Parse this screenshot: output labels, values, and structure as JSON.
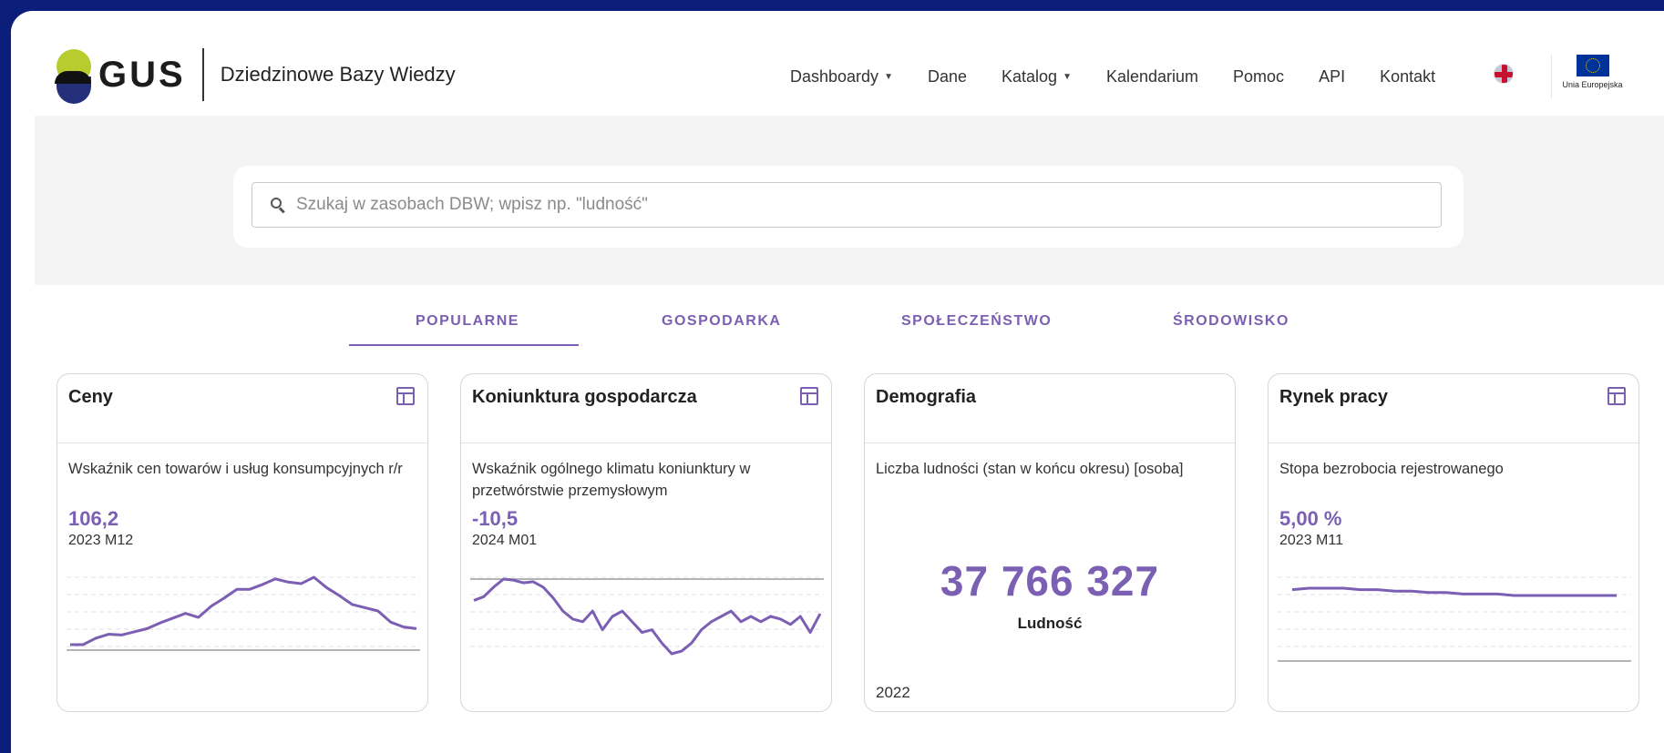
{
  "header": {
    "logo_text": "GUS",
    "site_title": "Dziedzinowe Bazy Wiedzy",
    "nav": [
      {
        "label": "Dashboardy",
        "dropdown": true
      },
      {
        "label": "Dane",
        "dropdown": false
      },
      {
        "label": "Katalog",
        "dropdown": true
      },
      {
        "label": "Kalendarium",
        "dropdown": false
      },
      {
        "label": "Pomoc",
        "dropdown": false
      },
      {
        "label": "API",
        "dropdown": false
      },
      {
        "label": "Kontakt",
        "dropdown": false
      }
    ],
    "language_icon": "uk-flag-icon",
    "eu_label": "Unia Europejska"
  },
  "search": {
    "placeholder": "Szukaj w zasobach DBW; wpisz np. \"ludność\""
  },
  "tabs": [
    {
      "label": "POPULARNE",
      "active": true
    },
    {
      "label": "GOSPODARKA",
      "active": false
    },
    {
      "label": "SPOŁECZEŃSTWO",
      "active": false
    },
    {
      "label": "ŚRODOWISKO",
      "active": false
    }
  ],
  "cards": [
    {
      "title": "Ceny",
      "indicator": "Wskaźnik cen towarów i usług konsumpcyjnych r/r",
      "value": "106,2",
      "period": "2023 M12"
    },
    {
      "title": "Koniunktura gospodarcza",
      "indicator": "Wskaźnik ogólnego klimatu koniunktury w przetwórstwie przemysłowym",
      "value": "-10,5",
      "period": "2024 M01"
    },
    {
      "title": "Demografia",
      "indicator": "Liczba ludności (stan w końcu okresu) [osoba]",
      "value": "37 766 327",
      "value_label": "Ludność",
      "period": "2022"
    },
    {
      "title": "Rynek pracy",
      "indicator": "Stopa bezrobocia rejestrowanego",
      "value": "5,00 %",
      "period": "2023 M11"
    }
  ],
  "colors": {
    "accent": "#7b5fb3",
    "frame_background": "#0b1f7a",
    "search_band": "#f4f4f5"
  },
  "chart_data": [
    {
      "type": "line",
      "series": [
        {
          "values": [
            101.6,
            101.6,
            102.4,
            102.9,
            102.8,
            103.2,
            103.6,
            104.3,
            104.9,
            105.5,
            105.0,
            106.4,
            107.4,
            108.5,
            108.5,
            109.1,
            109.8,
            109.4,
            109.2,
            110.0,
            108.7,
            107.7,
            106.6,
            106.2,
            105.8,
            104.4,
            103.8,
            103.6
          ]
        }
      ]
    },
    {
      "type": "line",
      "series": [
        {
          "values": [
            -4.5,
            -3.8,
            -2.0,
            -0.5,
            -0.7,
            -1.2,
            -1.0,
            -2.0,
            -4.0,
            -6.5,
            -8.0,
            -8.5,
            -6.5,
            -10.0,
            -7.5,
            -6.5,
            -8.5,
            -10.5,
            -10.0,
            -12.5,
            -14.5,
            -14.0,
            -12.5,
            -10.0,
            -8.5,
            -7.5,
            -6.5,
            -8.5,
            -7.5,
            -8.5,
            -7.5,
            -8.0,
            -9.0,
            -7.5,
            -10.5,
            -7.0
          ]
        }
      ]
    },
    {
      "type": "line",
      "series": [
        {
          "values": [
            5.6,
            5.7,
            5.7,
            5.7,
            5.6,
            5.6,
            5.5,
            5.5,
            5.4,
            5.4,
            5.3,
            5.3,
            5.3,
            5.2,
            5.2,
            5.2,
            5.2,
            5.2,
            5.2,
            5.2
          ]
        }
      ]
    }
  ]
}
